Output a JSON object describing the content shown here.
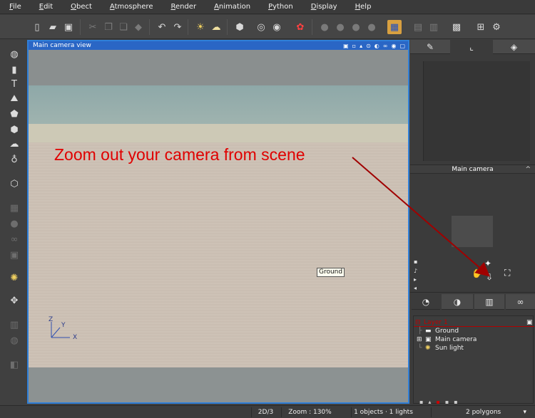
{
  "menu": [
    {
      "label": "File",
      "ul": "F",
      "rest": "ile"
    },
    {
      "label": "Edit",
      "ul": "E",
      "rest": "dit"
    },
    {
      "label": "Object",
      "ul": "O",
      "rest": "bect"
    },
    {
      "label": "Atmosphere",
      "ul": "A",
      "rest": "tmosphere"
    },
    {
      "label": "Render",
      "ul": "R",
      "rest": "ender"
    },
    {
      "label": "Animation",
      "ul": "A",
      "rest": "nimation"
    },
    {
      "label": "Python",
      "ul": "P",
      "rest": "ython"
    },
    {
      "label": "Display",
      "ul": "D",
      "rest": "isplay"
    },
    {
      "label": "Help",
      "ul": "H",
      "rest": "elp"
    }
  ],
  "viewport": {
    "title": "Main camera view",
    "ground_label": "Ground",
    "axis": {
      "x": "X",
      "y": "Y",
      "z": "Z"
    },
    "instruction": "Zoom out your camera from scene"
  },
  "camera_panel": {
    "title": "Main camera",
    "up_arrow": "^"
  },
  "layers": {
    "root": "Layer 1",
    "items": [
      "Ground",
      "Main camera",
      "Sun light"
    ]
  },
  "status": {
    "mode": "2D/3",
    "zoom": "Zoom : 130%",
    "counts": "1 objects · 1 lights",
    "polygons": "2 polygons"
  },
  "colors": {
    "accent_blue": "#2f7fd8",
    "instruction_red": "#e00000",
    "arrow_red": "#a00000"
  }
}
